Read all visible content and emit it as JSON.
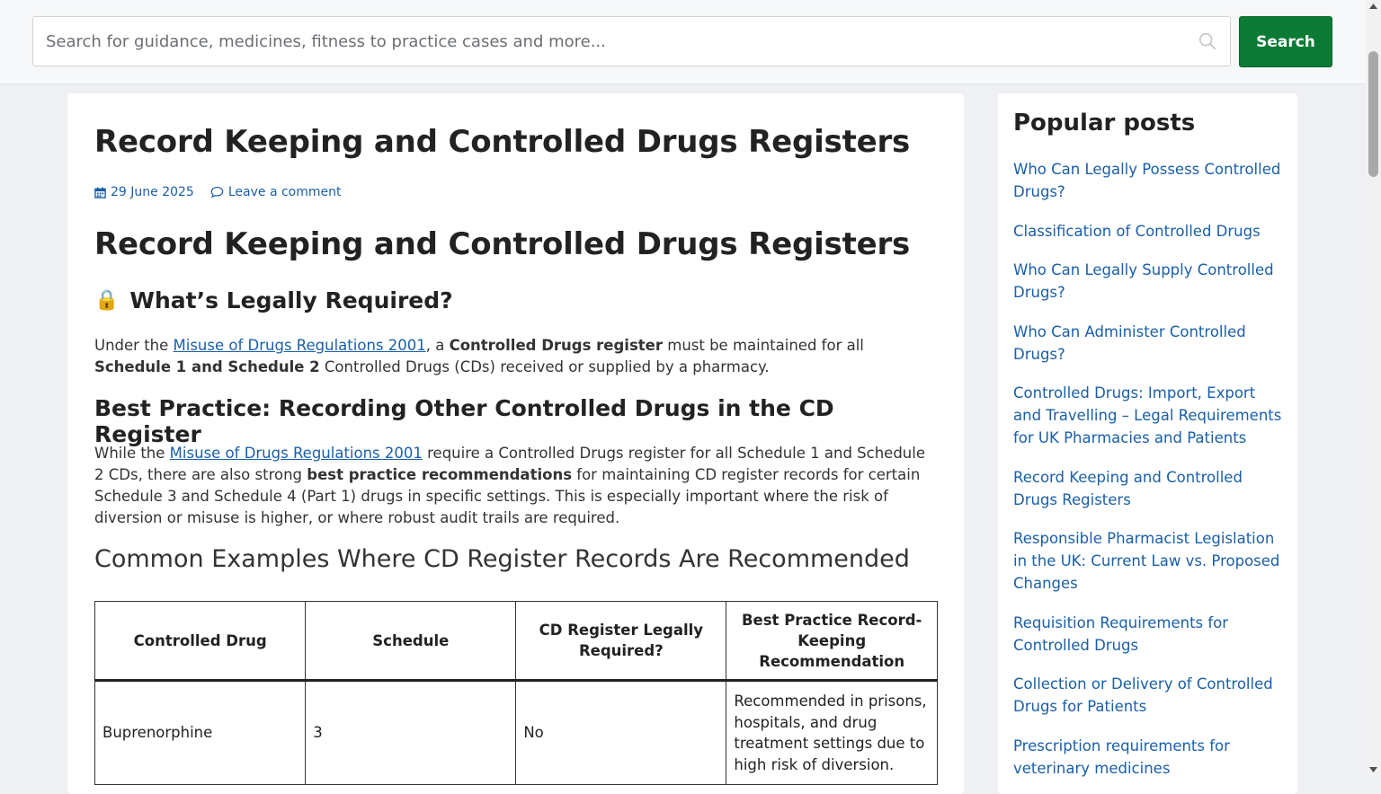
{
  "search": {
    "placeholder": "Search for guidance, medicines, fitness to practice cases and more...",
    "button_label": "Search"
  },
  "article": {
    "title": "Record Keeping and Controlled Drugs Registers",
    "date": "29 June 2025",
    "comment_link": "Leave a comment",
    "heading": "Record Keeping and Controlled Drugs Registers",
    "section1_emoji": "🔒",
    "section1_heading": "What’s Legally Required?",
    "para1": {
      "t1": "Under the ",
      "link": "Misuse of Drugs Regulations 2001",
      "t2": ", a ",
      "b1": "Controlled Drugs register",
      "t3": " must be maintained for all ",
      "b2": "Schedule 1 and Schedule 2",
      "t4": " Controlled Drugs (CDs) received or supplied by a pharmacy."
    },
    "section2_heading": "Best Practice: Recording Other Controlled Drugs in the CD Register",
    "para2": {
      "t1": "While the ",
      "link": "Misuse of Drugs Regulations 2001",
      "t2": " require a Controlled Drugs register for all Schedule 1 and Schedule 2 CDs, there are also strong ",
      "b1": "best practice recommendations",
      "t3": " for maintaining CD register records for certain Schedule 3 and Schedule 4 (Part 1) drugs in specific settings. This is especially important where the risk of diversion or misuse is higher, or where robust audit trails are required."
    },
    "section3_heading": "Common Examples Where CD Register Records Are Recommended",
    "table": {
      "headers": [
        "Controlled Drug",
        "Schedule",
        "CD Register Legally Required?",
        "Best Practice Record-Keeping Recommendation"
      ],
      "rows": [
        [
          "Buprenorphine",
          "3",
          "No",
          "Recommended in prisons, hospitals, and drug treatment settings due to high risk of diversion."
        ]
      ]
    }
  },
  "sidebar": {
    "title": "Popular posts",
    "posts": [
      "Who Can Legally Possess Controlled Drugs?",
      "Classification of Controlled Drugs",
      "Who Can Legally Supply Controlled Drugs?",
      "Who Can Administer Controlled Drugs?",
      "Controlled Drugs: Import, Export and Travelling – Legal Requirements for UK Pharmacies and Patients",
      "Record Keeping and Controlled Drugs Registers",
      "Responsible Pharmacist Legislation in the UK: Current Law vs. Proposed Changes",
      "Requisition Requirements for Controlled Drugs",
      "Collection or Delivery of Controlled Drugs for Patients",
      "Prescription requirements for veterinary medicines"
    ]
  },
  "colors": {
    "accent": "#0a7a35",
    "link": "#1a5fa8"
  },
  "icons": {
    "search": "search-icon",
    "date": "calendar-icon",
    "comment": "comment-icon"
  }
}
